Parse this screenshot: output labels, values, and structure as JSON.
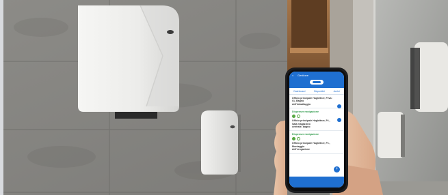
{
  "scene": {
    "wall_color": "#8f8f8c",
    "dispenser_color": "#eeeeec",
    "phone_accent": "#1f6fd0"
  },
  "phone": {
    "header_title": "Gestione",
    "back_label": "<",
    "tabs": [
      "Dashboard",
      "Dispositivi",
      "Avvisi"
    ],
    "cards": [
      {
        "alert": "",
        "text": "Ufficio principale Hagleitner, P.iva: 01, Bagno",
        "text2": "dell'imballaggio"
      },
      {
        "alert": "Dispenser navigazione",
        "text": "Ufficio principale Hagleitner, P.i., Sala magazzino",
        "text2": "centrale, bagno"
      },
      {
        "alert": "Dispenser navigazione",
        "text": "Ufficio principale Hagleitner, P.i., Montaggio",
        "text2": "dell'erogazione"
      }
    ],
    "fab_label": "+"
  }
}
